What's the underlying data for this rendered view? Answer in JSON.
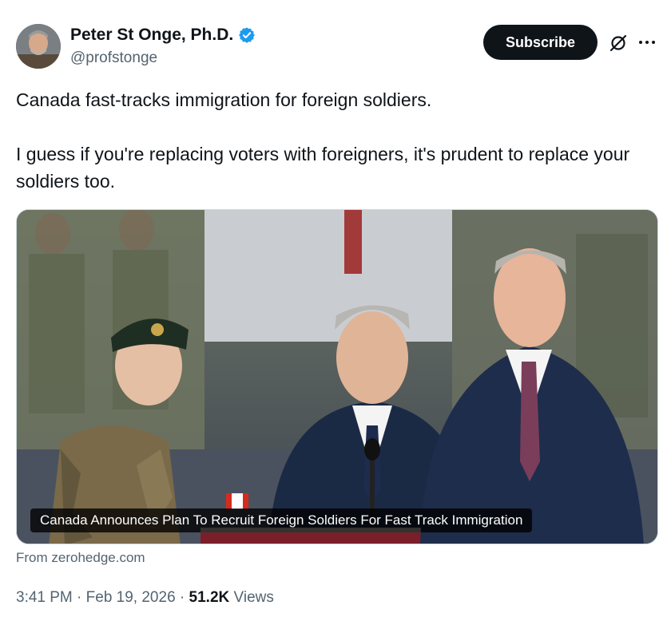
{
  "author": {
    "display_name": "Peter St Onge, Ph.D.",
    "handle": "@profstonge",
    "verified": true
  },
  "actions": {
    "subscribe_label": "Subscribe",
    "grok_icon": "grok-icon",
    "more_icon": "more-icon"
  },
  "tweet": {
    "paragraphs": [
      "Canada fast-tracks immigration for foreign soldiers.",
      "I guess if you're replacing voters with foreigners, it's prudent to replace your soldiers too."
    ]
  },
  "media": {
    "caption": "Canada Announces Plan To Recruit Foreign Soldiers For Fast Track Immigration",
    "source": "From zerohedge.com"
  },
  "meta": {
    "time": "3:41 PM",
    "date": "Feb 19, 2026",
    "views_count": "51.2K",
    "views_label": "Views"
  },
  "colors": {
    "verified": "#1d9bf0",
    "text": "#0f1419",
    "secondary": "#536471"
  }
}
